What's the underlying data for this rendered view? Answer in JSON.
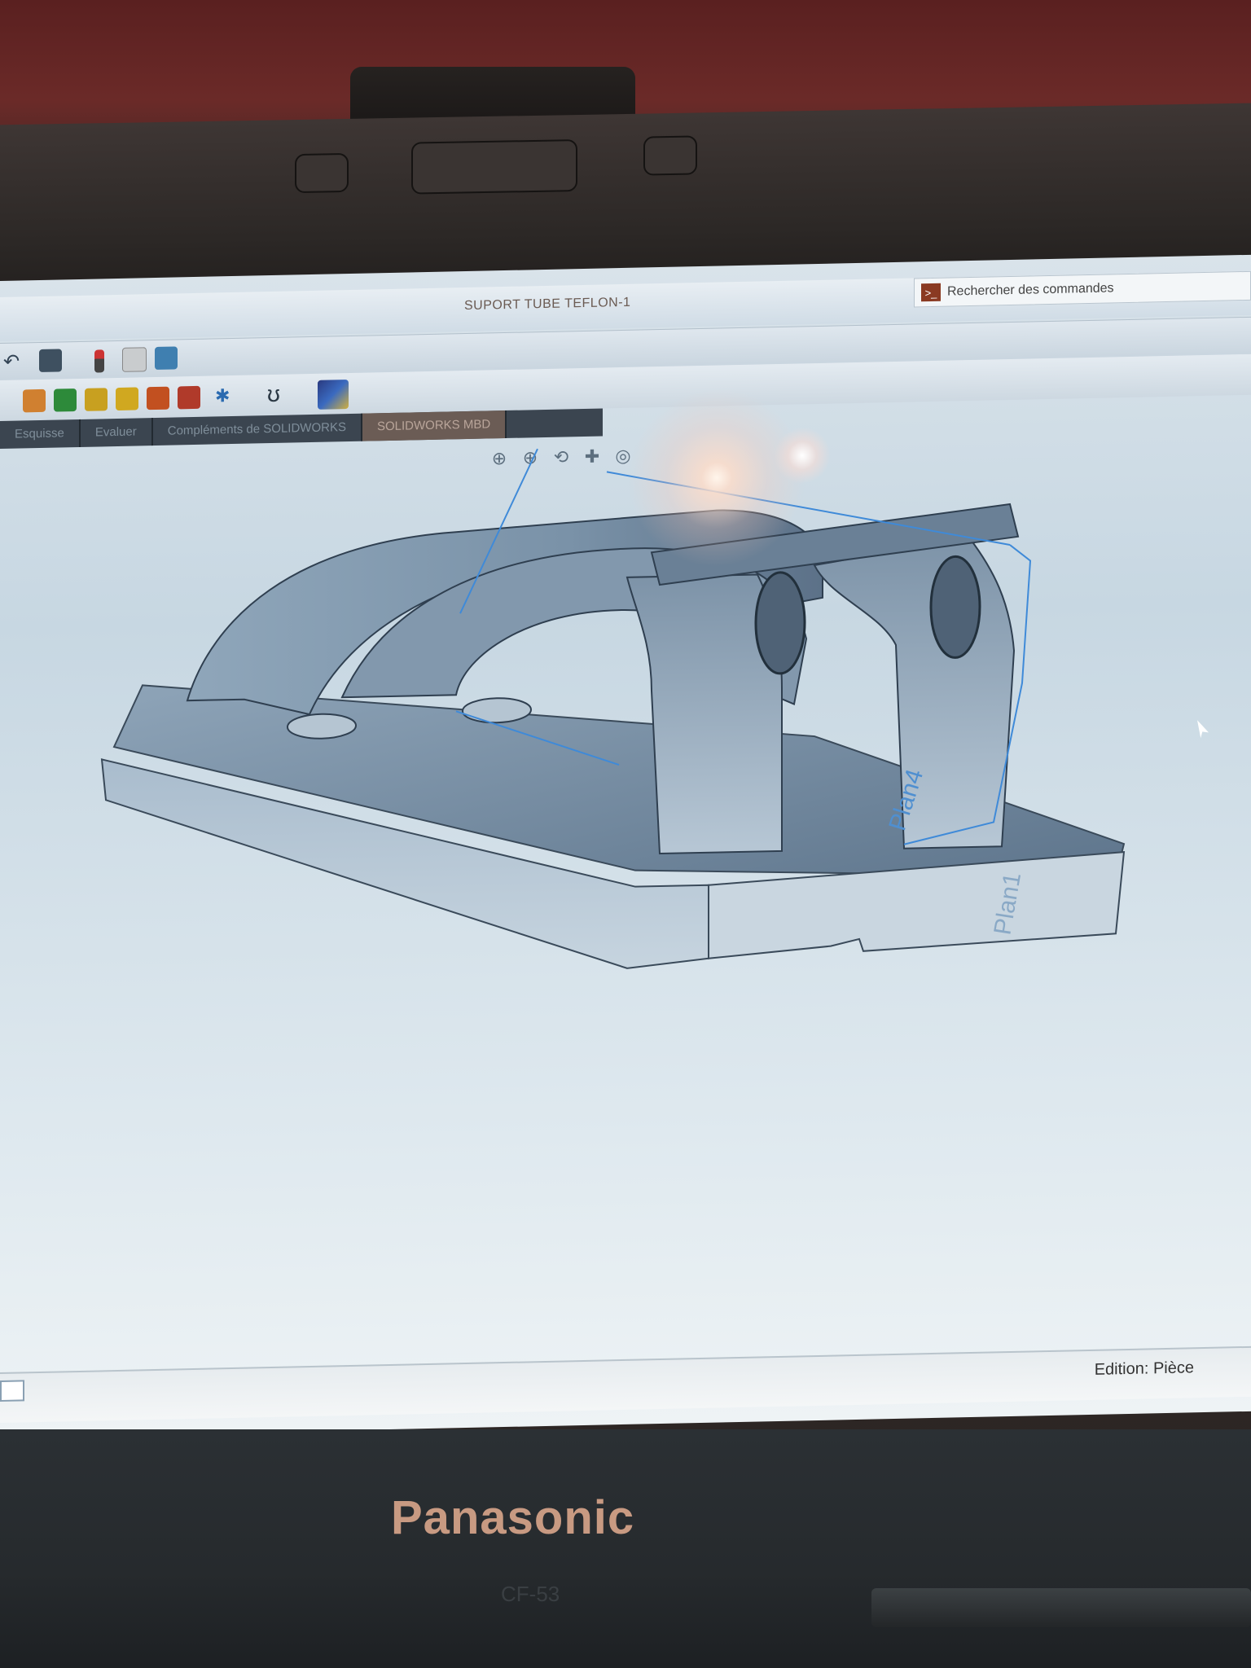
{
  "window": {
    "document_title": "SUPORT TUBE TEFLON-1",
    "search_placeholder": "Rechercher des commandes"
  },
  "tabs": [
    {
      "label": "Esquisse",
      "active": false
    },
    {
      "label": "Evaluer",
      "active": false
    },
    {
      "label": "Compléments de SOLIDWORKS",
      "active": false
    },
    {
      "label": "SOLIDWORKS MBD",
      "active": true
    }
  ],
  "model": {
    "plane_labels": [
      "Plan4",
      "Plan1"
    ]
  },
  "status": {
    "mode": "Edition: Pièce"
  },
  "laptop": {
    "brand": "Panasonic",
    "model": "CF-53"
  },
  "icons": {
    "toolbar": [
      "undo-icon",
      "select-arrow-icon",
      "traffic-light-icon",
      "options-icon",
      "display-icon"
    ],
    "features": [
      "feature-icon",
      "extrude-icon",
      "revolve-icon",
      "sweep-icon",
      "loft-icon",
      "pattern-icon",
      "reference-icon",
      "curve-icon",
      "appearance-icon"
    ],
    "view": [
      "zoom-to-fit-icon",
      "zoom-area-icon",
      "previous-view-icon",
      "section-view-icon",
      "view-orientation-icon"
    ]
  },
  "colors": {
    "model_body": "#9fb3c4",
    "plane_blue": "#3f8ad8",
    "brand_logo": "#c89a82"
  }
}
